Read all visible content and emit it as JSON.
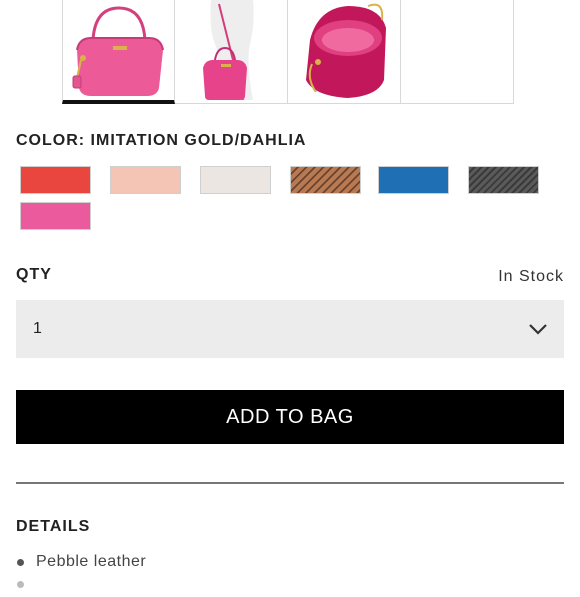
{
  "gallery": {
    "thumbnails": [
      {
        "name": "bag-front-view",
        "active": true
      },
      {
        "name": "bag-crossbody-view",
        "active": false
      },
      {
        "name": "bag-interior-view",
        "active": false
      },
      {
        "name": "empty-slot",
        "active": false
      }
    ]
  },
  "color": {
    "label": "COLOR: IMITATION GOLD/DAHLIA",
    "swatches": [
      {
        "name": "red",
        "color": "#e8463e",
        "pattern": "solid"
      },
      {
        "name": "blush",
        "color": "#f4c4b4",
        "pattern": "solid"
      },
      {
        "name": "chalk",
        "color": "#ebe6e2",
        "pattern": "solid"
      },
      {
        "name": "tan-stripe",
        "color": "#b97a52",
        "pattern": "stripe"
      },
      {
        "name": "blue",
        "color": "#1f6fb5",
        "pattern": "solid"
      },
      {
        "name": "grey-stripe",
        "color": "#5a5a5a",
        "pattern": "stripe"
      },
      {
        "name": "dahlia",
        "color": "#ea5a9c",
        "pattern": "solid"
      }
    ]
  },
  "qty": {
    "label": "QTY",
    "stock": "In Stock",
    "value": "1"
  },
  "add_button": "ADD TO BAG",
  "details": {
    "title": "DETAILS",
    "items": [
      "Pebble leather",
      ""
    ]
  }
}
